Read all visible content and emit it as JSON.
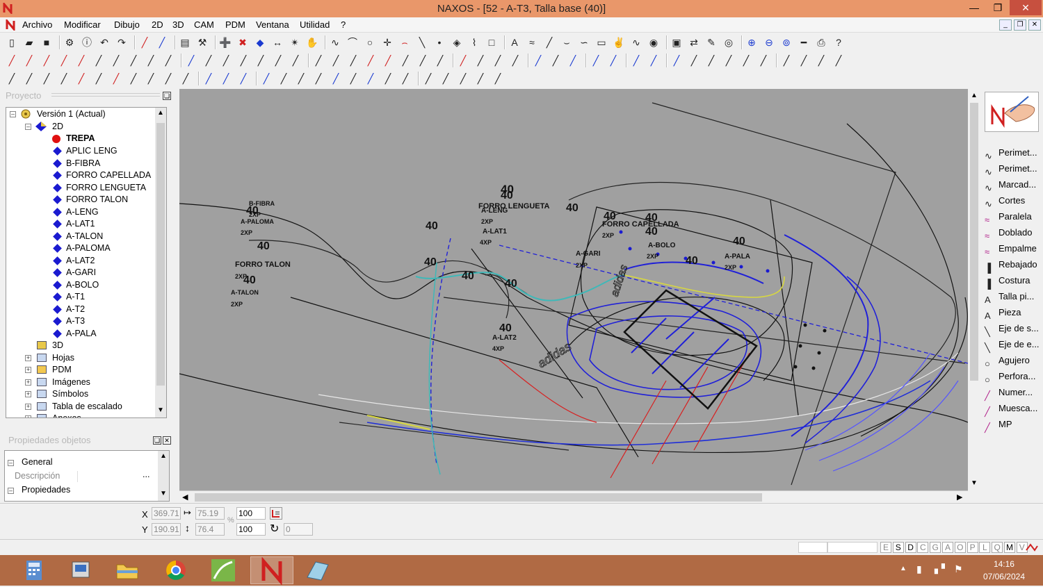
{
  "window": {
    "title": "NAXOS - [52 - A-T3, Talla base (40)]"
  },
  "menu": [
    "Archivo",
    "Modificar",
    "Dibujo",
    "2D",
    "3D",
    "CAM",
    "PDM",
    "Ventana",
    "Utilidad",
    "?"
  ],
  "project_panel": {
    "header": "Proyecto",
    "root": "Versión 1 (Actual)",
    "node_2d": "2D",
    "active_piece": "TREPA",
    "pieces": [
      "APLIC LENG",
      "B-FIBRA",
      "FORRO CAPELLADA",
      "FORRO LENGUETA",
      "FORRO TALON",
      "A-LENG",
      "A-LAT1",
      "A-TALON",
      "A-PALOMA",
      "A-LAT2",
      "A-GARI",
      "A-BOLO",
      "A-T1",
      "A-T2",
      "A-T3",
      "A-PALA"
    ],
    "others": [
      "3D",
      "Hojas",
      "PDM",
      "Imágenes",
      "Símbolos",
      "Tabla de escalado",
      "Anexos"
    ]
  },
  "props_panel": {
    "header": "Propiedades objetos",
    "general": "General",
    "descripcion": "Descripción",
    "propiedades": "Propiedades",
    "more": "..."
  },
  "canvas": {
    "labels": [
      {
        "t": "B-FIBRA"
      },
      {
        "t": "40"
      },
      {
        "t": "2XP"
      },
      {
        "t": "A-PALOMA"
      },
      {
        "t": "2XP"
      },
      {
        "t": "40"
      },
      {
        "t": "FORRO TALON"
      },
      {
        "t": "2XP"
      },
      {
        "t": "40"
      },
      {
        "t": "A-TALON"
      },
      {
        "t": "2XP"
      },
      {
        "t": "40"
      },
      {
        "t": "40"
      },
      {
        "t": "A-LENG"
      },
      {
        "t": "2XP"
      },
      {
        "t": "FORRO LENGUETA"
      },
      {
        "t": "40"
      },
      {
        "t": "40"
      },
      {
        "t": "FORRO CAPELLADA"
      },
      {
        "t": "2XP"
      },
      {
        "t": "A-LAT1"
      },
      {
        "t": "4XP"
      },
      {
        "t": "40"
      },
      {
        "t": "40"
      },
      {
        "t": "40"
      },
      {
        "t": "A-BOLO"
      },
      {
        "t": "2XP"
      },
      {
        "t": "A-GARI"
      },
      {
        "t": "2XP"
      },
      {
        "t": "40"
      },
      {
        "t": "A-PALA"
      },
      {
        "t": "2XP"
      },
      {
        "t": "40"
      },
      {
        "t": "40"
      },
      {
        "t": "40"
      },
      {
        "t": "40"
      },
      {
        "t": "A-LAT2"
      },
      {
        "t": "4XP"
      },
      {
        "t": "40"
      }
    ],
    "brand": "adidas"
  },
  "right_tools": [
    "Perimet...",
    "Perimet...",
    "Marcad...",
    "Cortes",
    "Paralela",
    "Doblado",
    "Empalme",
    "Rebajado",
    "Costura",
    "Talla pi...",
    "Pieza",
    "Eje de s...",
    "Eje de e...",
    "Agujero",
    "Perfora...",
    "Numer...",
    "Muesca...",
    "MP"
  ],
  "coords": {
    "x_label": "X",
    "y_label": "Y",
    "x": "369.71",
    "y": "190.91",
    "w": "75.19",
    "h": "76.4",
    "sx": "100",
    "sy": "100",
    "rot": "0",
    "pct": "%"
  },
  "status_flags": [
    "E",
    "S",
    "D",
    "C",
    "G",
    "A",
    "O",
    "P",
    "L",
    "Q",
    "M",
    "V"
  ],
  "clock": {
    "time": "14:16",
    "date": "07/06/2024"
  },
  "colors": {
    "titlebar": "#e9976a",
    "taskbar": "#b06a44",
    "canvas": "#a0a0a0"
  }
}
